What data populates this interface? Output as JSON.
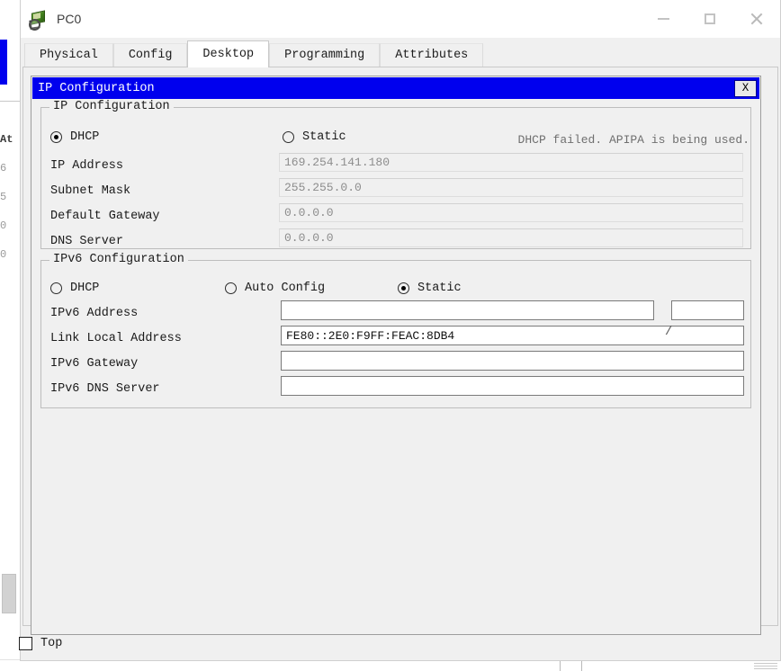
{
  "window": {
    "title": "PC0",
    "icon": "device-pc-icon",
    "controls": {
      "minimize": "minimize-icon",
      "maximize": "maximize-icon",
      "close": "close-icon"
    }
  },
  "tabs": [
    {
      "label": "Physical",
      "active": false
    },
    {
      "label": "Config",
      "active": false
    },
    {
      "label": "Desktop",
      "active": true
    },
    {
      "label": "Programming",
      "active": false
    },
    {
      "label": "Attributes",
      "active": false
    }
  ],
  "dialog": {
    "title": "IP Configuration",
    "close_label": "X",
    "accent_color": "#0000ee"
  },
  "ipv4": {
    "legend": "IP Configuration",
    "mode_options": [
      {
        "label": "DHCP",
        "selected": true
      },
      {
        "label": "Static",
        "selected": false
      }
    ],
    "status_message": "DHCP failed. APIPA is being used.",
    "fields": [
      {
        "label": "IP Address",
        "value": "169.254.141.180",
        "enabled": false
      },
      {
        "label": "Subnet Mask",
        "value": "255.255.0.0",
        "enabled": false
      },
      {
        "label": "Default Gateway",
        "value": "0.0.0.0",
        "enabled": false
      },
      {
        "label": "DNS Server",
        "value": "0.0.0.0",
        "enabled": false
      }
    ]
  },
  "ipv6": {
    "legend": "IPv6 Configuration",
    "mode_options": [
      {
        "label": "DHCP",
        "selected": false
      },
      {
        "label": "Auto Config",
        "selected": false
      },
      {
        "label": "Static",
        "selected": true
      }
    ],
    "prefix_separator": "/",
    "fields": [
      {
        "label": "IPv6 Address",
        "value": "",
        "enabled": true
      },
      {
        "label": "Link Local Address",
        "value": "FE80::2E0:F9FF:FEAC:8DB4",
        "enabled": true
      },
      {
        "label": "IPv6 Gateway",
        "value": "",
        "enabled": true
      },
      {
        "label": "IPv6 DNS Server",
        "value": "",
        "enabled": true
      }
    ],
    "prefix_value": ""
  },
  "footer": {
    "top_checkbox_label": "Top",
    "top_checked": false
  },
  "background": {
    "left_fragments": [
      "At",
      "6",
      "5",
      "0",
      "0"
    ]
  }
}
